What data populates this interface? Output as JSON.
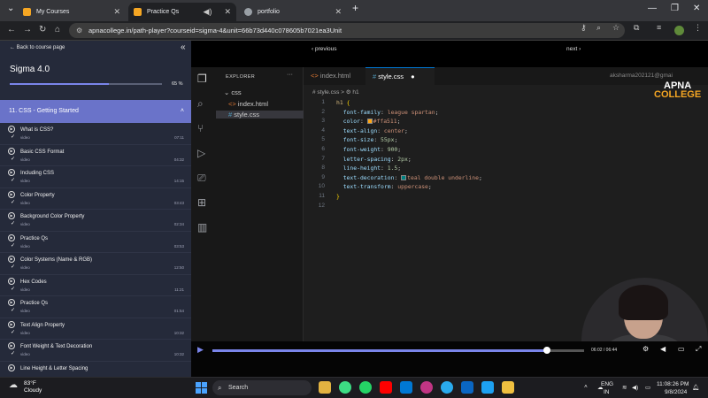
{
  "browser": {
    "tabs": [
      {
        "title": "My Courses",
        "fav": "#f5a623",
        "active": false
      },
      {
        "title": "Practice Qs",
        "fav": "#f5a623",
        "active": true
      },
      {
        "title": "portfolio",
        "fav": "#9aa0a6",
        "active": false
      }
    ],
    "new_tab": "+",
    "url": "apnacollege.in/path-player?courseid=sigma-4&unit=66b73d440c078605b7021ea3Unit"
  },
  "sidebar": {
    "back_link": "← Back to course page",
    "course_title": "Sigma 4.0",
    "progress_percent": 65,
    "progress_label": "65 %",
    "section_title": "11. CSS - Getting Started",
    "lessons": [
      {
        "title": "What is CSS?",
        "type": "video",
        "duration": "07:11"
      },
      {
        "title": "Basic CSS Format",
        "type": "video",
        "duration": "04:32"
      },
      {
        "title": "Including CSS",
        "type": "video",
        "duration": "14:15"
      },
      {
        "title": "Color Property",
        "type": "video",
        "duration": "03:43"
      },
      {
        "title": "Background Color Property",
        "type": "video",
        "duration": "02:34"
      },
      {
        "title": "Practice Qs",
        "type": "video",
        "duration": "03:53"
      },
      {
        "title": "Color Systems (Name & RGB)",
        "type": "video",
        "duration": "12:50"
      },
      {
        "title": "Hex Codes",
        "type": "video",
        "duration": "11:21"
      },
      {
        "title": "Practice Qs",
        "type": "video",
        "duration": "01:54"
      },
      {
        "title": "Text Align Property",
        "type": "video",
        "duration": "10:32"
      },
      {
        "title": "Font Weight & Text Decoration",
        "type": "video",
        "duration": "10:32"
      },
      {
        "title": "Line Height & Letter Spacing",
        "type": "",
        "duration": ""
      }
    ]
  },
  "player": {
    "prev_label": "‹ previous",
    "next_label": "next ›",
    "time": "06:02 / 06:44",
    "progress_fraction": 0.9
  },
  "vscode": {
    "explorer_title": "EXPLORER",
    "folder": "css",
    "files": [
      "index.html",
      "style.css"
    ],
    "tabs": [
      "index.html",
      "style.css"
    ],
    "breadcrumb": "# style.css > ⚙ h1",
    "user": "aksharma202121@gmai",
    "logo_line1": "APNA",
    "logo_line2": "COLLEGE",
    "lines": [
      "h1 {",
      "  font-family: league spartan;",
      "  color: #ffa511;",
      "  text-align: center;",
      "  font-size: 55px;",
      "  font-weight: 900;",
      "  letter-spacing: 2px;",
      "  line-height: 1.5;",
      "  text-decoration: teal double underline;",
      "  text-transform: uppercase;",
      "}",
      ""
    ]
  },
  "taskbar": {
    "weather_temp": "83°F",
    "weather_desc": "Cloudy",
    "search_placeholder": "Search",
    "lang1": "ENG",
    "lang2": "IN",
    "time": "11:08:26 PM",
    "date": "9/8/2024"
  },
  "colors": {
    "accent": "#7a85ea",
    "section": "#6a73c9",
    "orange": "#ffa511",
    "teal": "#008080"
  }
}
